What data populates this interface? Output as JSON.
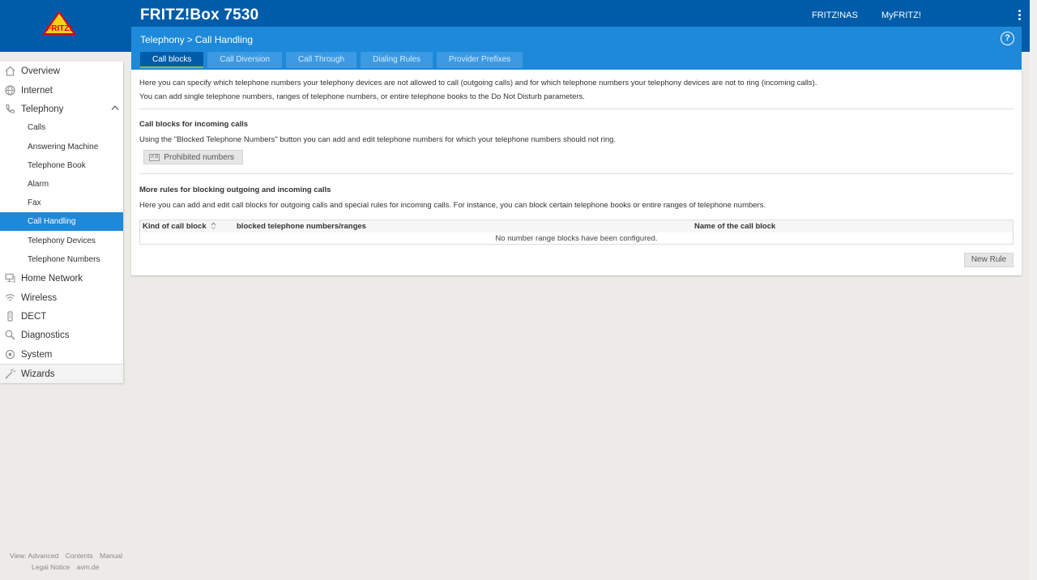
{
  "header": {
    "title": "FRITZ!Box 7530",
    "logo_text": "FRITZ!",
    "links": [
      "FRITZ!NAS",
      "MyFRITZ!"
    ]
  },
  "breadcrumb": {
    "parent": "Telephony",
    "separator": ">",
    "current": "Call Handling",
    "help": "?"
  },
  "tabs": [
    {
      "label": "Call blocks",
      "active": true
    },
    {
      "label": "Call Diversion",
      "active": false
    },
    {
      "label": "Call Through",
      "active": false
    },
    {
      "label": "Dialing Rules",
      "active": false
    },
    {
      "label": "Provider Prefixes",
      "active": false
    }
  ],
  "sidebar": {
    "items": [
      {
        "label": "Overview",
        "icon": "home-icon"
      },
      {
        "label": "Internet",
        "icon": "globe-icon"
      },
      {
        "label": "Telephony",
        "icon": "phone-icon",
        "expanded": true
      },
      {
        "label": "Home Network",
        "icon": "network-icon"
      },
      {
        "label": "Wireless",
        "icon": "wifi-icon"
      },
      {
        "label": "DECT",
        "icon": "dect-icon"
      },
      {
        "label": "Diagnostics",
        "icon": "diagnostics-icon"
      },
      {
        "label": "System",
        "icon": "system-icon"
      },
      {
        "label": "Wizards",
        "icon": "wizard-icon"
      }
    ],
    "telephony_sub": [
      {
        "label": "Calls"
      },
      {
        "label": "Answering Machine"
      },
      {
        "label": "Telephone Book"
      },
      {
        "label": "Alarm"
      },
      {
        "label": "Fax"
      },
      {
        "label": "Call Handling",
        "active": true
      },
      {
        "label": "Telephony Devices"
      },
      {
        "label": "Telephone Numbers"
      }
    ]
  },
  "main": {
    "intro_line1": "Here you can specify which telephone numbers your telephony devices are not allowed to call (outgoing calls) and for which telephone numbers your telephony devices are not to ring (incoming calls).",
    "intro_line2": "You can add single telephone numbers, ranges of telephone numbers, or entire telephone books to the Do Not Disturb parameters.",
    "incoming_title": "Call blocks for incoming calls",
    "incoming_text": "Using the \"Blocked Telephone Numbers\" button you can add and edit telephone numbers for which your telephone numbers should not ring.",
    "prohibited_button": "Prohibited numbers",
    "prohibited_icon_text": "A B",
    "rules_title": "More rules for blocking outgoing and incoming calls",
    "rules_text": "Here you can add and edit call blocks for outgoing calls and special rules for incoming calls. For instance, you can block certain telephone books or entire ranges of telephone numbers.",
    "table": {
      "columns": [
        "Kind of call block",
        "blocked telephone numbers/ranges",
        "Name of the call block"
      ],
      "empty_message": "No number range blocks have been configured."
    },
    "new_rule_button": "New Rule"
  },
  "footer": {
    "row1": [
      "View: Advanced",
      "Contents",
      "Manual"
    ],
    "row2": [
      "Legal Notice",
      "avm.de"
    ]
  },
  "colors": {
    "header_blue": "#005ca9",
    "bar_blue": "#1e89d9",
    "active_underline": "#80c240"
  }
}
